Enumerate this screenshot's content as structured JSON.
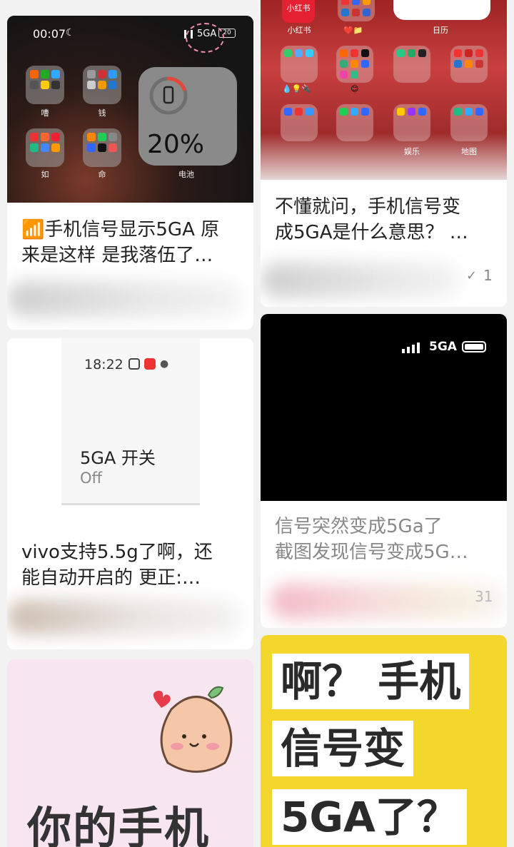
{
  "cards": [
    {
      "cover": {
        "time": "00:07",
        "network": "5GA",
        "battery_badge": "20",
        "folders": [
          "嘈",
          "钱",
          "如",
          "命"
        ],
        "battery_widget_value": "20%",
        "battery_label": "电池"
      },
      "title_line1": "📶手机信号显示5GA 原",
      "title_line2": "来是这样 是我落伍了…"
    },
    {
      "cover": {
        "top_labels": [
          "小红书",
          "日历"
        ],
        "row_labels": [
          "娱乐",
          "地图"
        ]
      },
      "title_line1": "不懂就问，手机信号变",
      "title_line2": "成5GA是什么意思？ …",
      "likes": "1"
    },
    {
      "cover": {
        "time": "18:22",
        "toggle_label": "5GA 开关",
        "toggle_state": "Off"
      },
      "title_line1": "vivo支持5.5g了啊，还",
      "title_line2": "能自动开启的 更正:…"
    },
    {
      "cover": {
        "network": "5GA"
      },
      "title_line1": "信号突然变成5Ga了",
      "title_line2": "截图发现信号变成5G…",
      "likes": "31"
    },
    {
      "cover": {
        "text": "你的手机"
      }
    },
    {
      "cover": {
        "line1": "啊？ 手机",
        "line2": "信号变",
        "line3": "5GA了？"
      }
    }
  ]
}
